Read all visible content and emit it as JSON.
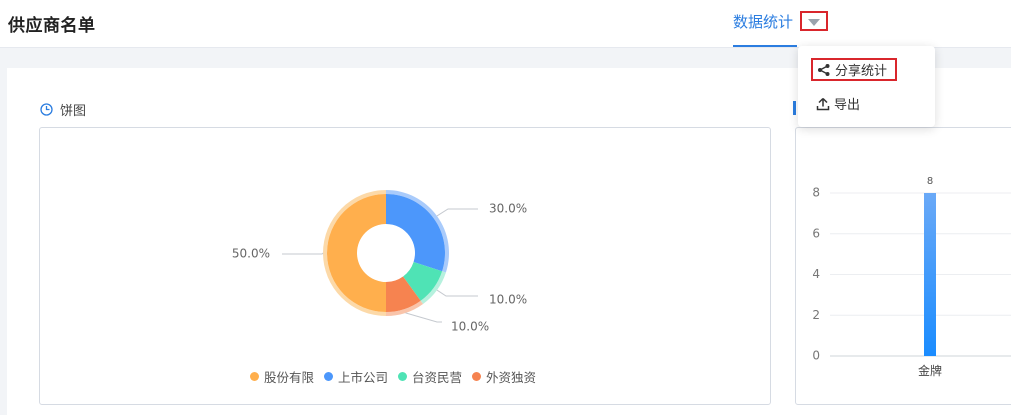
{
  "header": {
    "title": "供应商名单",
    "tab_label": "数据统计"
  },
  "dropdown": {
    "items": [
      {
        "label": "分享统计",
        "icon": "share-icon"
      },
      {
        "label": "导出",
        "icon": "upload-icon"
      }
    ]
  },
  "pie_section": {
    "title": "饼图",
    "icon": "pie-clock-icon"
  },
  "colors": {
    "accent": "#2b7de0",
    "highlight_border": "#d9262c",
    "orange": "#ffaf4d",
    "blue": "#4c97fb",
    "green": "#4fe3b5",
    "coral": "#f68350"
  },
  "chart_data": [
    {
      "type": "pie",
      "categories": [
        "股份有限",
        "上市公司",
        "台资民营",
        "外资独资"
      ],
      "values": [
        50,
        30,
        10,
        10
      ],
      "labels": [
        "50.0%",
        "30.0%",
        "10.0%",
        "10.0%"
      ],
      "legend": "bottom",
      "donut": true
    },
    {
      "type": "bar",
      "categories": [
        "金牌"
      ],
      "values": [
        8
      ],
      "yticks": [
        "0",
        "2",
        "4",
        "6",
        "8"
      ],
      "ylim": [
        0,
        8
      ],
      "data_labels": [
        "8"
      ],
      "grid": true
    }
  ]
}
